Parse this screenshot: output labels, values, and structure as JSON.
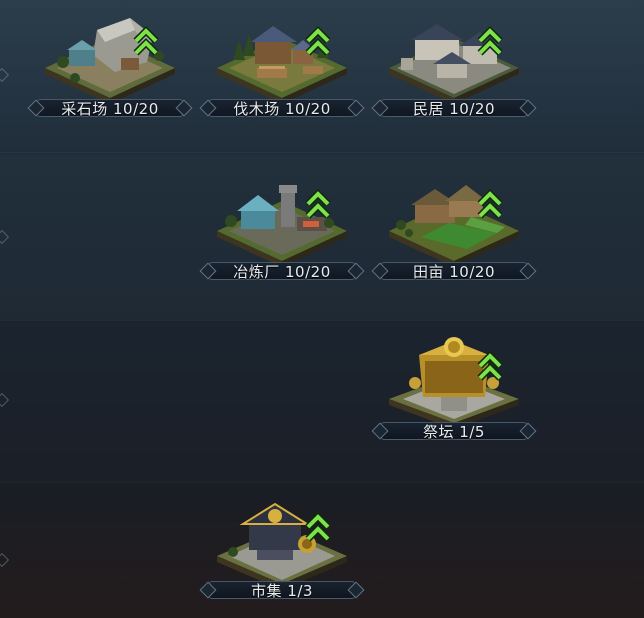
{
  "buildings": [
    {
      "id": "quarry",
      "label": "采石场 10/20",
      "upgradable": true,
      "icon": "quarry-building-icon"
    },
    {
      "id": "lumber",
      "label": "伐木场 10/20",
      "upgradable": true,
      "icon": "lumber-mill-building-icon"
    },
    {
      "id": "residence",
      "label": "民居 10/20",
      "upgradable": true,
      "icon": "residence-building-icon"
    },
    {
      "id": "smelter",
      "label": "冶炼厂 10/20",
      "upgradable": true,
      "icon": "smelter-building-icon"
    },
    {
      "id": "farmland",
      "label": "田亩 10/20",
      "upgradable": true,
      "icon": "farmland-building-icon"
    },
    {
      "id": "altar",
      "label": "祭坛 1/5",
      "upgradable": true,
      "icon": "altar-building-icon"
    },
    {
      "id": "market",
      "label": "市集 1/3",
      "upgradable": true,
      "icon": "market-building-icon"
    }
  ],
  "colors": {
    "upgrade_arrow": "#7ee04a",
    "label_text": "#e8ecef",
    "label_border": "#7890a0"
  }
}
